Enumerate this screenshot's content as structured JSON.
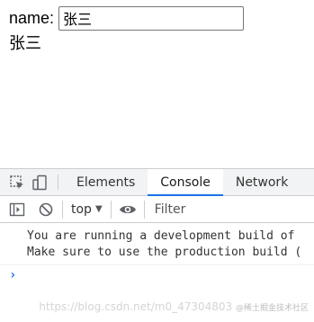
{
  "page": {
    "name_label": "name:",
    "name_value": "张三",
    "name_output": "张三"
  },
  "devtools": {
    "tabs": [
      {
        "label": "Elements",
        "active": false
      },
      {
        "label": "Console",
        "active": true
      },
      {
        "label": "Network",
        "active": false
      }
    ],
    "toolbar": {
      "context": "top",
      "filter_placeholder": "Filter"
    },
    "console": {
      "messages": [
        {
          "line1": "You are running a development build of",
          "line2": "Make sure to use the production build ("
        }
      ]
    }
  },
  "watermark": {
    "text": "https://blog.csdn.net/m0_47304803",
    "sub": "@稀土掘金技术社区"
  },
  "colors": {
    "accent": "#1a73e8",
    "tabbar_bg": "#f1f3f4",
    "border": "#cbcdd1"
  },
  "icons": [
    "inspect-element-icon",
    "device-toggle-icon",
    "sidebar-toggle-icon",
    "clear-console-icon",
    "eye-icon",
    "prompt-chevron-icon"
  ]
}
